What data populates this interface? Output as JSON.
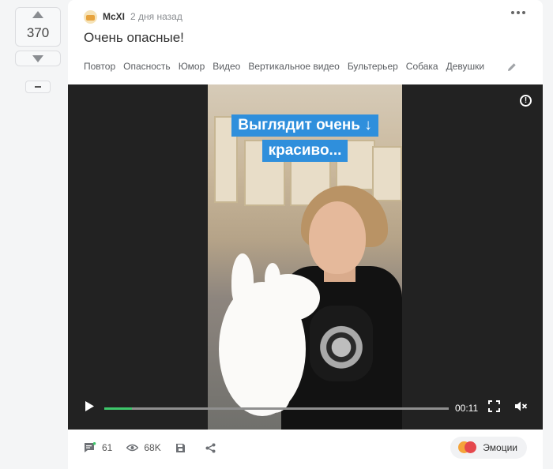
{
  "vote": {
    "rating": "370"
  },
  "post": {
    "author": "McXI",
    "time": "2 дня назад",
    "title": "Очень опасные!",
    "tags": [
      "Повтор",
      "Опасность",
      "Юмор",
      "Видео",
      "Вертикальное видео",
      "Бультерьер",
      "Собака",
      "Девушки"
    ]
  },
  "video": {
    "caption_line1": "Выглядит очень ↓",
    "caption_line2": "красиво...",
    "duration": "00:11",
    "progress": 0.08
  },
  "footer": {
    "comments": "61",
    "views": "68K",
    "emotions_label": "Эмоции"
  },
  "colors": {
    "accent_green": "#3ec76b",
    "caption_blue": "#2f8fdc",
    "video_bg": "#222222"
  }
}
